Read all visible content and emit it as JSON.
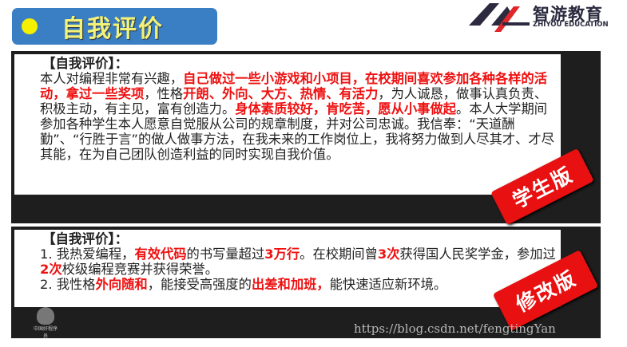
{
  "header": {
    "title": "自我评价",
    "accent": "#3a7fc4"
  },
  "logo": {
    "name_cn": "智游教育",
    "name_en": "ZHIYOU EDUCATION"
  },
  "student": {
    "heading": "【自我评价】：",
    "segments": [
      {
        "t": "本人对编程非常有兴趣，",
        "hl": false
      },
      {
        "t": "自己做过一些小游戏和小项目，在校期间喜欢参加各种各样的活动，拿过一些奖项",
        "hl": true
      },
      {
        "t": "，性格",
        "hl": false
      },
      {
        "t": "开朗、外向、大方、热情、有活力",
        "hl": true
      },
      {
        "t": "，为人诚恳，做事认真负责、积极主动，有主见，富有创造力。",
        "hl": false
      },
      {
        "t": "身体素质较好，肯吃苦，愿从小事做起",
        "hl": true
      },
      {
        "t": "。本人大学期间参加各种学生本人愿意自觉服从公司的规章制度，并对公司忠诚。我信奉：“天道酬勤”、“行胜于言”的做人做事方法，在我未来的工作岗位上，我将努力做到人尽其才、才尽其能，在为自己团队创造利益的同时实现自我价值。",
        "hl": false
      }
    ],
    "stamp": "学生版"
  },
  "revised": {
    "heading": "【自我评价】：",
    "segments": [
      {
        "t": "1. 我热爱编程，",
        "hl": false
      },
      {
        "t": "有效代码",
        "hl": true
      },
      {
        "t": "的书写量超过",
        "hl": false
      },
      {
        "t": "3万行",
        "hl": true
      },
      {
        "t": "。在校期间曾",
        "hl": false
      },
      {
        "t": "3次",
        "hl": true
      },
      {
        "t": "获得国人民奖学金，参加过",
        "hl": false
      },
      {
        "t": "2次",
        "hl": true
      },
      {
        "t": "校级编程竞赛并获得荣誉。\n",
        "hl": false
      },
      {
        "t": "2. 我性格",
        "hl": false
      },
      {
        "t": "外向随和",
        "hl": true
      },
      {
        "t": "，能接受高强度的",
        "hl": false
      },
      {
        "t": "出差和加班，",
        "hl": true
      },
      {
        "t": "能快速适应新环境。",
        "hl": false
      }
    ],
    "stamp": "修改版"
  },
  "emblem_text": "中国好程序员",
  "watermark": "https://blog.csdn.net/fengtingYan",
  "colors": {
    "highlight": "#ee1111",
    "stamp": "#e81010"
  }
}
